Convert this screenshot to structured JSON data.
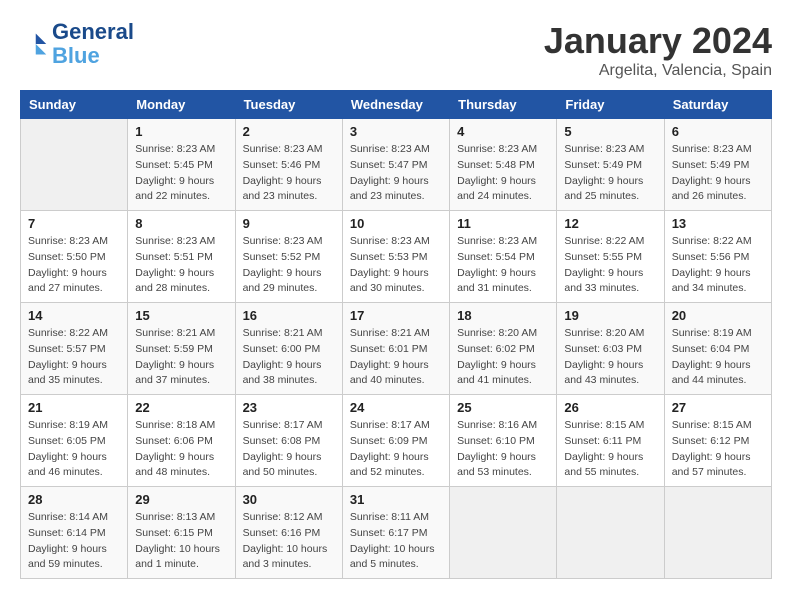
{
  "logo": {
    "text_general": "General",
    "text_blue": "Blue"
  },
  "header": {
    "title": "January 2024",
    "subtitle": "Argelita, Valencia, Spain"
  },
  "days_of_week": [
    "Sunday",
    "Monday",
    "Tuesday",
    "Wednesday",
    "Thursday",
    "Friday",
    "Saturday"
  ],
  "weeks": [
    [
      {
        "day": "",
        "info": ""
      },
      {
        "day": "1",
        "info": "Sunrise: 8:23 AM\nSunset: 5:45 PM\nDaylight: 9 hours\nand 22 minutes."
      },
      {
        "day": "2",
        "info": "Sunrise: 8:23 AM\nSunset: 5:46 PM\nDaylight: 9 hours\nand 23 minutes."
      },
      {
        "day": "3",
        "info": "Sunrise: 8:23 AM\nSunset: 5:47 PM\nDaylight: 9 hours\nand 23 minutes."
      },
      {
        "day": "4",
        "info": "Sunrise: 8:23 AM\nSunset: 5:48 PM\nDaylight: 9 hours\nand 24 minutes."
      },
      {
        "day": "5",
        "info": "Sunrise: 8:23 AM\nSunset: 5:49 PM\nDaylight: 9 hours\nand 25 minutes."
      },
      {
        "day": "6",
        "info": "Sunrise: 8:23 AM\nSunset: 5:49 PM\nDaylight: 9 hours\nand 26 minutes."
      }
    ],
    [
      {
        "day": "7",
        "info": "Sunrise: 8:23 AM\nSunset: 5:50 PM\nDaylight: 9 hours\nand 27 minutes."
      },
      {
        "day": "8",
        "info": "Sunrise: 8:23 AM\nSunset: 5:51 PM\nDaylight: 9 hours\nand 28 minutes."
      },
      {
        "day": "9",
        "info": "Sunrise: 8:23 AM\nSunset: 5:52 PM\nDaylight: 9 hours\nand 29 minutes."
      },
      {
        "day": "10",
        "info": "Sunrise: 8:23 AM\nSunset: 5:53 PM\nDaylight: 9 hours\nand 30 minutes."
      },
      {
        "day": "11",
        "info": "Sunrise: 8:23 AM\nSunset: 5:54 PM\nDaylight: 9 hours\nand 31 minutes."
      },
      {
        "day": "12",
        "info": "Sunrise: 8:22 AM\nSunset: 5:55 PM\nDaylight: 9 hours\nand 33 minutes."
      },
      {
        "day": "13",
        "info": "Sunrise: 8:22 AM\nSunset: 5:56 PM\nDaylight: 9 hours\nand 34 minutes."
      }
    ],
    [
      {
        "day": "14",
        "info": "Sunrise: 8:22 AM\nSunset: 5:57 PM\nDaylight: 9 hours\nand 35 minutes."
      },
      {
        "day": "15",
        "info": "Sunrise: 8:21 AM\nSunset: 5:59 PM\nDaylight: 9 hours\nand 37 minutes."
      },
      {
        "day": "16",
        "info": "Sunrise: 8:21 AM\nSunset: 6:00 PM\nDaylight: 9 hours\nand 38 minutes."
      },
      {
        "day": "17",
        "info": "Sunrise: 8:21 AM\nSunset: 6:01 PM\nDaylight: 9 hours\nand 40 minutes."
      },
      {
        "day": "18",
        "info": "Sunrise: 8:20 AM\nSunset: 6:02 PM\nDaylight: 9 hours\nand 41 minutes."
      },
      {
        "day": "19",
        "info": "Sunrise: 8:20 AM\nSunset: 6:03 PM\nDaylight: 9 hours\nand 43 minutes."
      },
      {
        "day": "20",
        "info": "Sunrise: 8:19 AM\nSunset: 6:04 PM\nDaylight: 9 hours\nand 44 minutes."
      }
    ],
    [
      {
        "day": "21",
        "info": "Sunrise: 8:19 AM\nSunset: 6:05 PM\nDaylight: 9 hours\nand 46 minutes."
      },
      {
        "day": "22",
        "info": "Sunrise: 8:18 AM\nSunset: 6:06 PM\nDaylight: 9 hours\nand 48 minutes."
      },
      {
        "day": "23",
        "info": "Sunrise: 8:17 AM\nSunset: 6:08 PM\nDaylight: 9 hours\nand 50 minutes."
      },
      {
        "day": "24",
        "info": "Sunrise: 8:17 AM\nSunset: 6:09 PM\nDaylight: 9 hours\nand 52 minutes."
      },
      {
        "day": "25",
        "info": "Sunrise: 8:16 AM\nSunset: 6:10 PM\nDaylight: 9 hours\nand 53 minutes."
      },
      {
        "day": "26",
        "info": "Sunrise: 8:15 AM\nSunset: 6:11 PM\nDaylight: 9 hours\nand 55 minutes."
      },
      {
        "day": "27",
        "info": "Sunrise: 8:15 AM\nSunset: 6:12 PM\nDaylight: 9 hours\nand 57 minutes."
      }
    ],
    [
      {
        "day": "28",
        "info": "Sunrise: 8:14 AM\nSunset: 6:14 PM\nDaylight: 9 hours\nand 59 minutes."
      },
      {
        "day": "29",
        "info": "Sunrise: 8:13 AM\nSunset: 6:15 PM\nDaylight: 10 hours\nand 1 minute."
      },
      {
        "day": "30",
        "info": "Sunrise: 8:12 AM\nSunset: 6:16 PM\nDaylight: 10 hours\nand 3 minutes."
      },
      {
        "day": "31",
        "info": "Sunrise: 8:11 AM\nSunset: 6:17 PM\nDaylight: 10 hours\nand 5 minutes."
      },
      {
        "day": "",
        "info": ""
      },
      {
        "day": "",
        "info": ""
      },
      {
        "day": "",
        "info": ""
      }
    ]
  ]
}
